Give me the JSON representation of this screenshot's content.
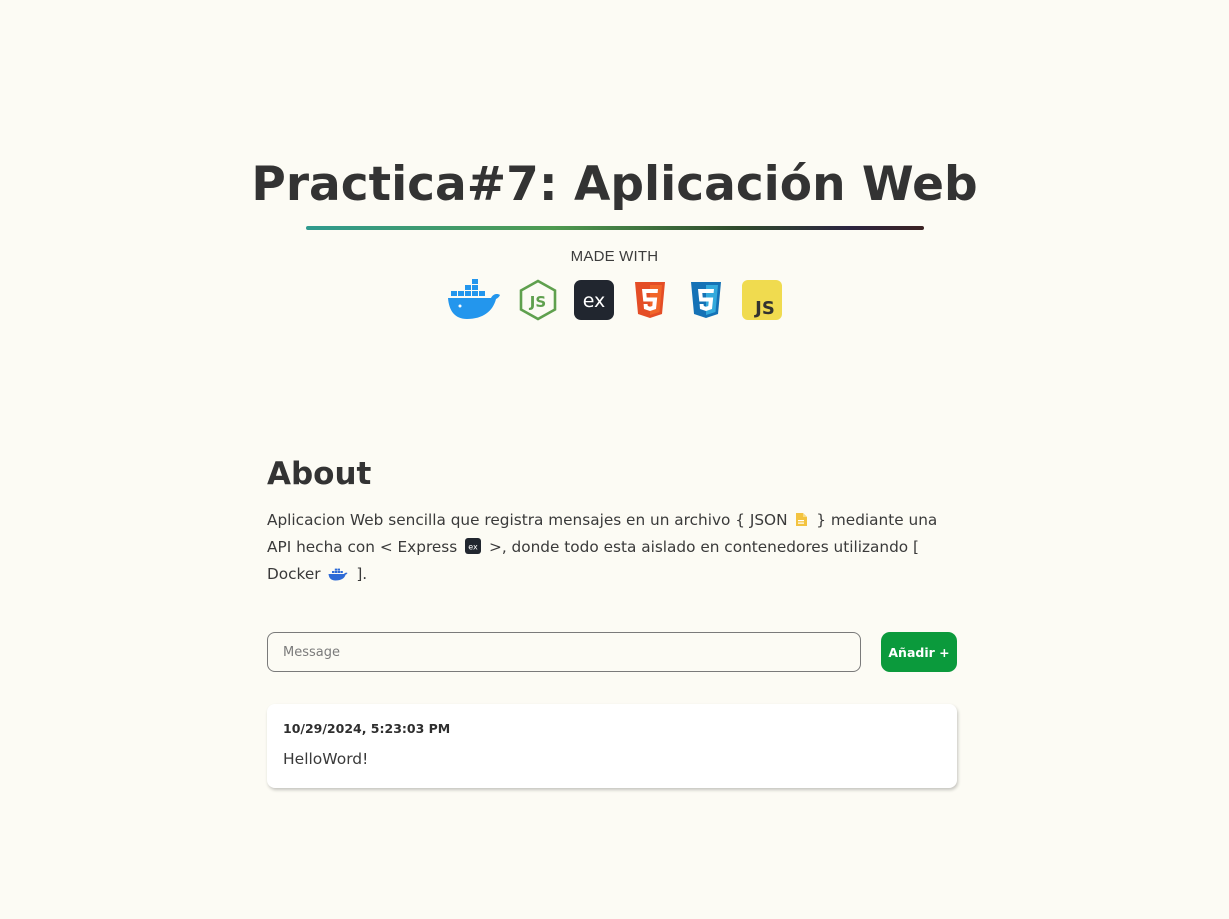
{
  "header": {
    "title": "Practica#7: Aplicación Web",
    "made_with": "MADE WITH",
    "tech_icons": [
      "docker-icon",
      "nodejs-icon",
      "express-icon",
      "html5-icon",
      "css3-icon",
      "javascript-icon"
    ]
  },
  "about": {
    "title": "About",
    "text_part1": "Aplicacion Web sencilla que registra mensajes en un archivo { JSON",
    "text_part2": "} mediante una API hecha con < Express",
    "text_part3": ">, donde todo esta aislado en contenedores utilizando [ Docker",
    "text_part4": "]."
  },
  "form": {
    "placeholder": "Message",
    "value": "",
    "add_label": "Añadir +"
  },
  "messages": [
    {
      "date": "10/29/2024, 5:23:03 PM",
      "text": "HelloWord!"
    }
  ],
  "colors": {
    "background": "#fcfbf4",
    "accent_green": "#0b9a3c",
    "text": "#333333"
  }
}
